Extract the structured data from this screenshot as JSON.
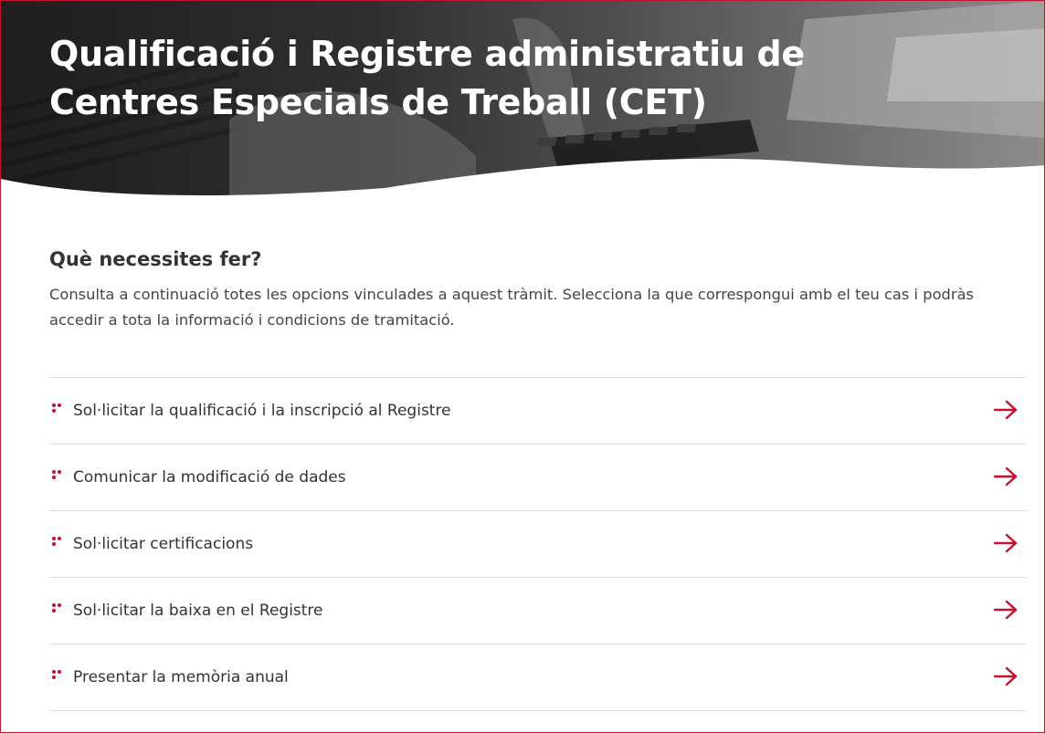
{
  "hero": {
    "title": "Qualificació i Registre administratiu de Centres Especials de Treball (CET)"
  },
  "section": {
    "heading": "Què necessites fer?",
    "description": "Consulta a continuació totes les opcions vinculades a aquest tràmit. Selecciona la que correspongui amb el teu cas i podràs accedir a tota la informació i condicions de tramitació."
  },
  "options": [
    {
      "label": "Sol·licitar la qualificació i la inscripció al Registre",
      "icon": "arrow-right-icon"
    },
    {
      "label": "Comunicar la modificació de dades",
      "icon": "arrow-right-icon"
    },
    {
      "label": "Sol·licitar certificacions",
      "icon": "arrow-right-icon"
    },
    {
      "label": "Sol·licitar la baixa en el Registre",
      "icon": "arrow-right-icon"
    },
    {
      "label": "Presentar la memòria anual",
      "icon": "arrow-right-icon"
    }
  ],
  "colors": {
    "accent": "#c8102e",
    "text": "#333333",
    "divider": "#dddddd",
    "hero_overlay": "#2b2b2b"
  }
}
